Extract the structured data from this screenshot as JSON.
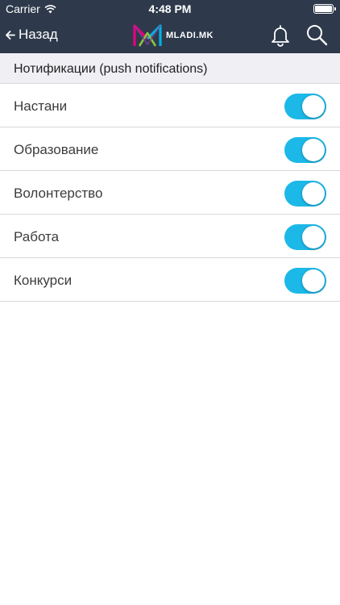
{
  "status_bar": {
    "carrier": "Carrier",
    "time": "4:48 PM"
  },
  "nav": {
    "back_label": "Назад",
    "logo_text": "MLADI.MK"
  },
  "section": {
    "title": "Нотификации (push notifications)"
  },
  "settings": [
    {
      "label": "Настани",
      "enabled": true
    },
    {
      "label": "Образование",
      "enabled": true
    },
    {
      "label": "Волонтерство",
      "enabled": true
    },
    {
      "label": "Работа",
      "enabled": true
    },
    {
      "label": "Конкурси",
      "enabled": true
    }
  ],
  "colors": {
    "header_bg": "#2e3a4b",
    "toggle_on": "#1cb8e8",
    "section_bg": "#efeff4"
  }
}
